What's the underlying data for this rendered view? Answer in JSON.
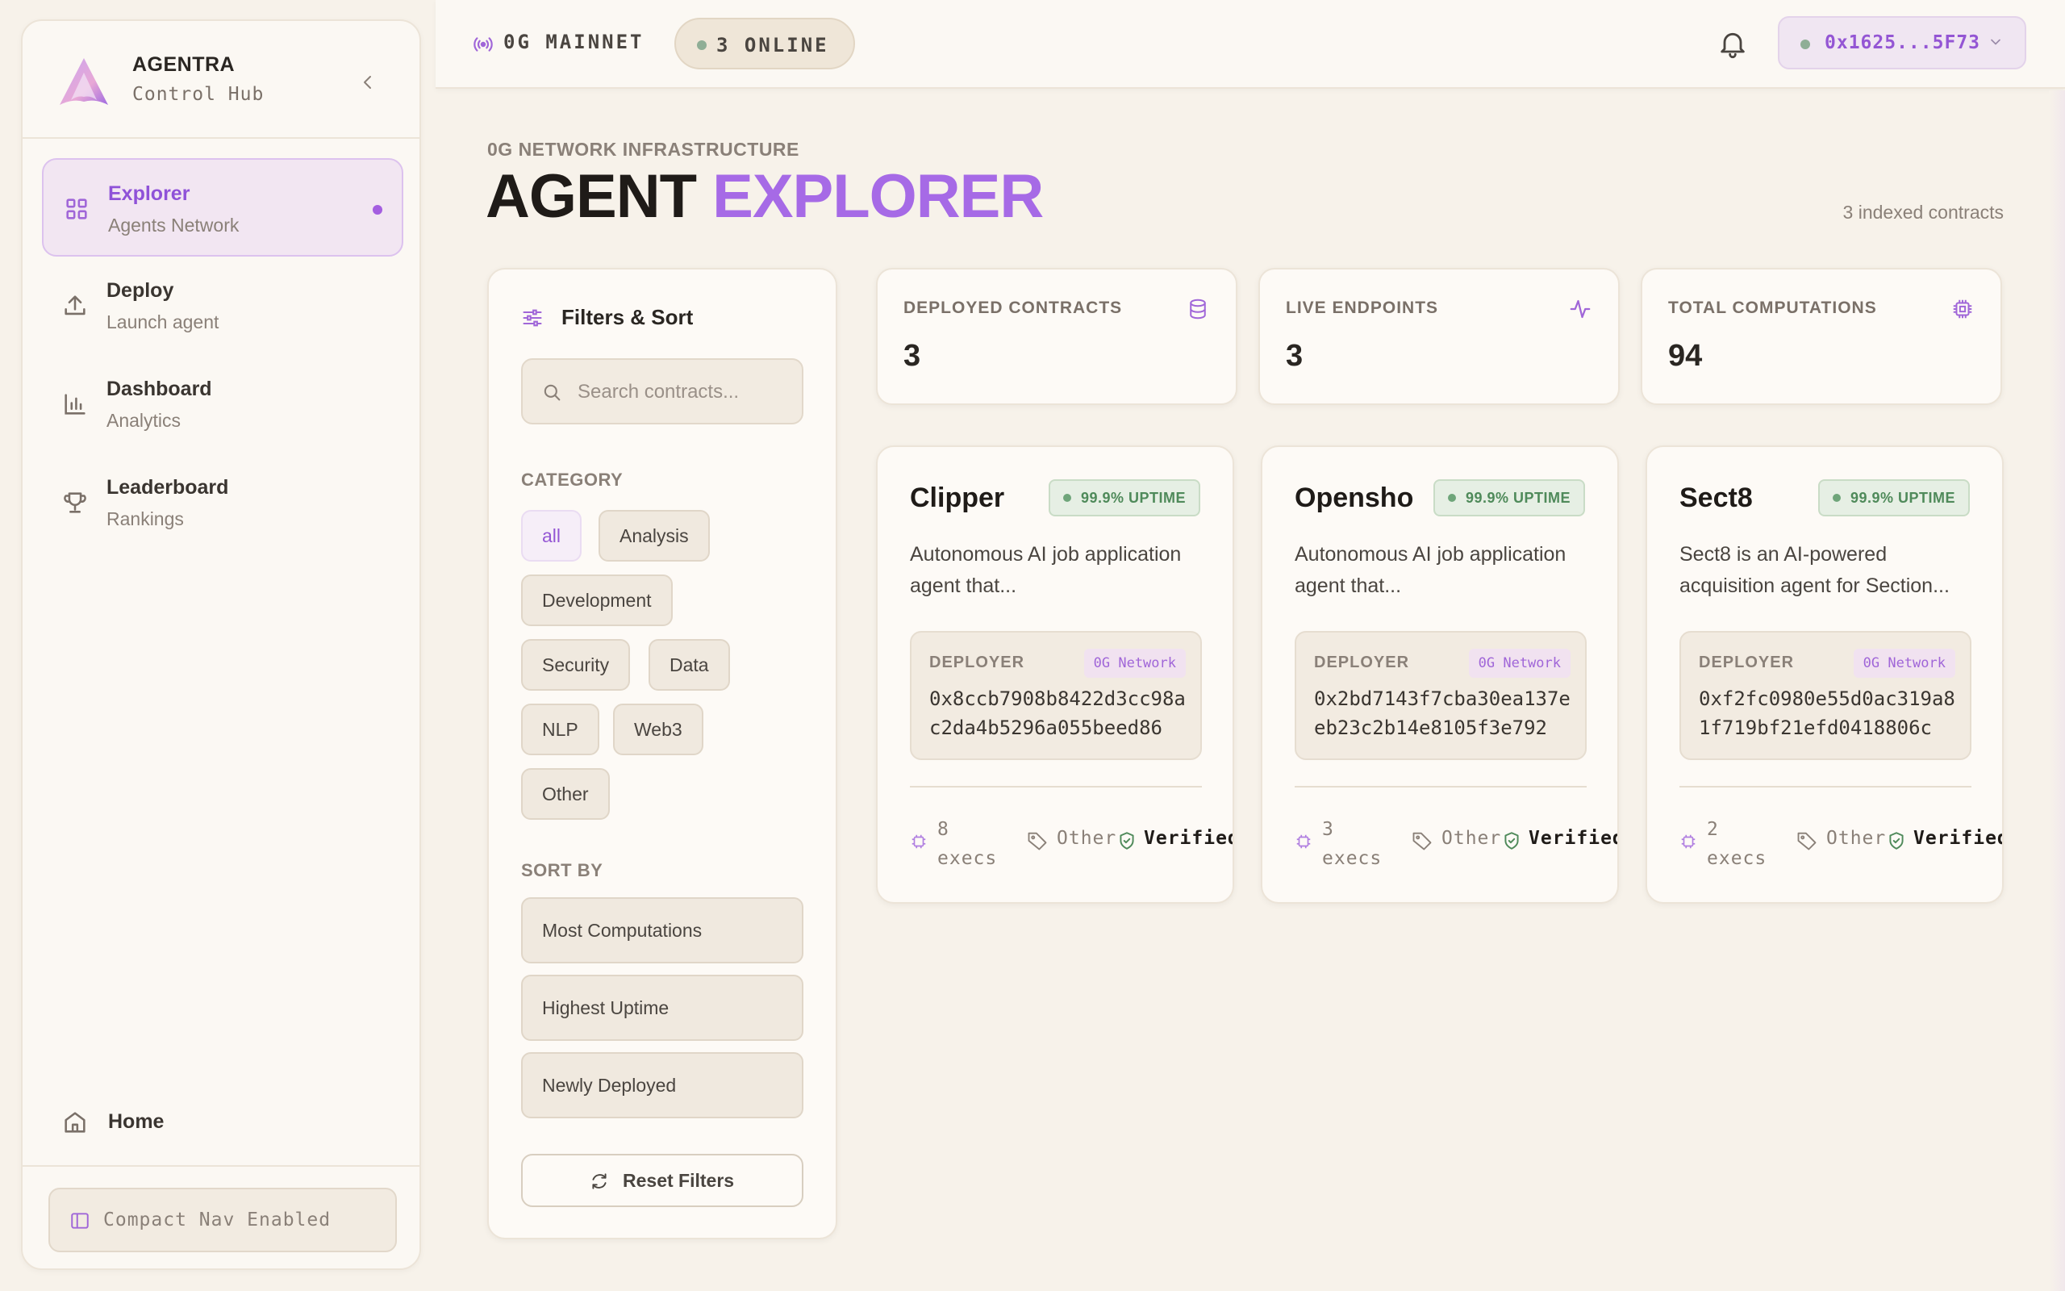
{
  "brand": {
    "name": "AGENTRA",
    "subtitle": "Control Hub"
  },
  "nav": [
    {
      "title": "Explorer",
      "subtitle": "Agents Network",
      "active": true
    },
    {
      "title": "Deploy",
      "subtitle": "Launch agent"
    },
    {
      "title": "Dashboard",
      "subtitle": "Analytics"
    },
    {
      "title": "Leaderboard",
      "subtitle": "Rankings"
    }
  ],
  "home_label": "Home",
  "compact_label": "Compact Nav Enabled",
  "topbar": {
    "network": "0G MAINNET",
    "online": "3 ONLINE",
    "wallet": "0x1625...5F73"
  },
  "page": {
    "eyebrow": "0G NETWORK INFRASTRUCTURE",
    "title_main": "AGENT",
    "title_accent": "EXPLORER",
    "indexed": "3 indexed contracts"
  },
  "filters": {
    "title": "Filters & Sort",
    "search_placeholder": "Search contracts...",
    "category_label": "CATEGORY",
    "categories": [
      "all",
      "Analysis",
      "Development",
      "Security",
      "Data",
      "NLP",
      "Web3",
      "Other"
    ],
    "sort_label": "SORT BY",
    "sort_options": [
      "Most Computations",
      "Highest Uptime",
      "Newly Deployed"
    ],
    "reset_label": "Reset Filters"
  },
  "stats": [
    {
      "label": "DEPLOYED CONTRACTS",
      "value": "3",
      "icon": "database-icon"
    },
    {
      "label": "LIVE ENDPOINTS",
      "value": "3",
      "icon": "activity-icon"
    },
    {
      "label": "TOTAL COMPUTATIONS",
      "value": "94",
      "icon": "cpu-icon"
    }
  ],
  "agents": [
    {
      "name": "Clipper",
      "uptime": "99.9% UPTIME",
      "description": "Autonomous AI job application agent that...",
      "deployer_label": "DEPLOYER",
      "network": "0G Network",
      "address": "0x8ccb7908b8422d3cc98ac2da4b5296a055beed86",
      "execs_count": "8",
      "execs_unit": "execs",
      "category": "Other",
      "verified": "Verified"
    },
    {
      "name": "Opensho",
      "uptime": "99.9% UPTIME",
      "description": "Autonomous AI job application agent that...",
      "deployer_label": "DEPLOYER",
      "network": "0G Network",
      "address": "0x2bd7143f7cba30ea137eeb23c2b14e8105f3e792",
      "execs_count": "3",
      "execs_unit": "execs",
      "category": "Other",
      "verified": "Verified"
    },
    {
      "name": "Sect8",
      "uptime": "99.9% UPTIME",
      "description": "Sect8 is an AI-powered acquisition agent for Section...",
      "deployer_label": "DEPLOYER",
      "network": "0G Network",
      "address": "0xf2fc0980e55d0ac319a81f719bf21efd0418806c",
      "execs_count": "2",
      "execs_unit": "execs",
      "category": "Other",
      "verified": "Verified"
    }
  ],
  "colors": {
    "accent": "#a66ae6",
    "success": "#4f8a5a",
    "background": "#f7f2ea"
  }
}
